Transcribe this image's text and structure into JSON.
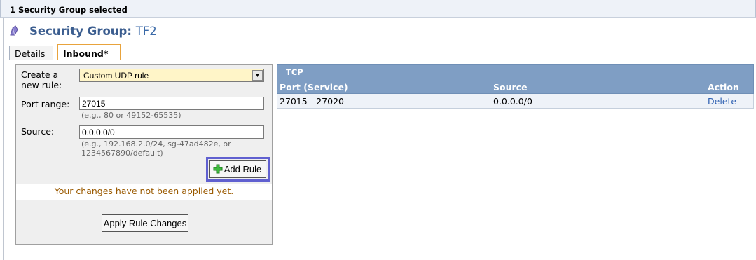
{
  "selection_bar": {
    "text": "1 Security Group selected"
  },
  "header": {
    "title_prefix": "Security Group:",
    "group_name": "TF2"
  },
  "tabs": [
    {
      "label": "Details"
    },
    {
      "label": "Inbound*"
    }
  ],
  "form": {
    "create_rule_label_line1": "Create a",
    "create_rule_label_line2": "new rule:",
    "rule_type_selected": "Custom UDP rule",
    "port_range_label": "Port range:",
    "port_range_value": "27015",
    "port_range_hint": "(e.g., 80 or 49152-65535)",
    "source_label": "Source:",
    "source_value": "0.0.0.0/0",
    "source_hint_line1": "(e.g., 192.168.2.0/24, sg-47ad482e, or",
    "source_hint_line2": "1234567890/default)",
    "add_rule_label": "Add Rule",
    "notice": "Your changes have not been applied yet.",
    "apply_label": "Apply Rule Changes"
  },
  "rules_table": {
    "group_label": "TCP",
    "columns": {
      "port": "Port (Service)",
      "source": "Source",
      "action": "Action"
    },
    "rows": [
      {
        "port": "27015 - 27020",
        "source": "0.0.0.0/0",
        "action": "Delete"
      }
    ]
  },
  "colors": {
    "title": "#3b5d8f",
    "table_header": "#7f9ec4",
    "notice": "#9a5a00",
    "highlight": "#6060d0",
    "tab_active_border": "#e8a33d"
  }
}
